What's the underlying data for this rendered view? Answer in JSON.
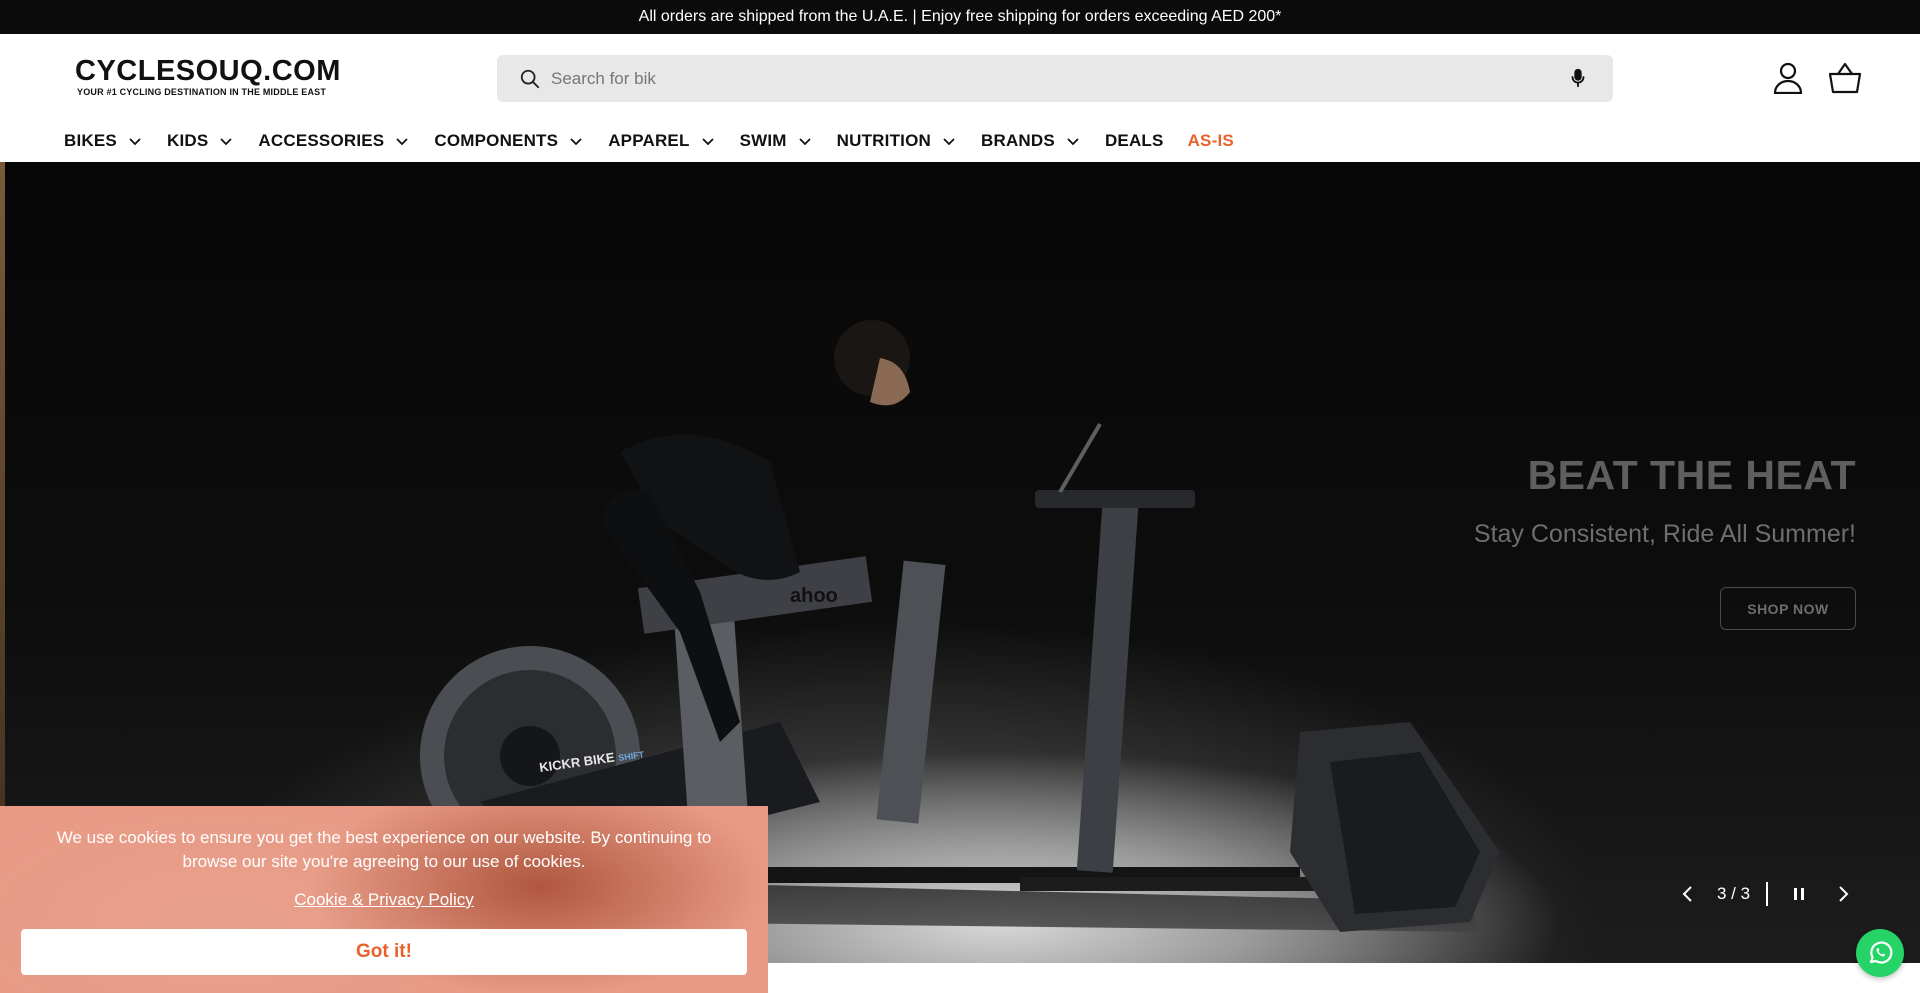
{
  "announcement": {
    "text": "All orders are shipped from the U.A.E. | Enjoy free shipping for orders exceeding AED 200*"
  },
  "header": {
    "logo_main": "CYCLESOUQ.COM",
    "logo_tagline": "YOUR #1 CYCLING DESTINATION IN THE MIDDLE EAST",
    "search": {
      "value": "",
      "placeholder": "Search for bik"
    },
    "icons": [
      "search-icon",
      "microphone-icon",
      "account-icon",
      "cart-icon"
    ]
  },
  "nav": {
    "items": [
      {
        "label": "BIKES",
        "has_dropdown": true
      },
      {
        "label": "KIDS",
        "has_dropdown": true
      },
      {
        "label": "ACCESSORIES",
        "has_dropdown": true
      },
      {
        "label": "COMPONENTS",
        "has_dropdown": true
      },
      {
        "label": "APPAREL",
        "has_dropdown": true
      },
      {
        "label": "SWIM",
        "has_dropdown": true
      },
      {
        "label": "NUTRITION",
        "has_dropdown": true
      },
      {
        "label": "BRANDS",
        "has_dropdown": true
      },
      {
        "label": "DEALS",
        "has_dropdown": false
      },
      {
        "label": "AS-IS",
        "has_dropdown": false
      }
    ],
    "sale_color": "#e8622a"
  },
  "hero": {
    "title": "BEAT THE HEAT",
    "subtitle": "Stay Consistent, Ride All Summer!",
    "cta": "SHOP NOW",
    "trainer_label": "KICKR BIKE",
    "trainer_label_suffix": "SHIFT",
    "frame_brand": "ahoo",
    "slider": {
      "current": 3,
      "total": 3,
      "counter_text": "3 / 3"
    }
  },
  "cookie_banner": {
    "message": "We use cookies to ensure you get the best experience on our website. By continuing to browse our site you're agreeing to our use of cookies.",
    "link_text": "Cookie & Privacy Policy",
    "button_label": "Got it!"
  },
  "colors": {
    "announce_bg": "#0b0b0b",
    "accent": "#e8622a",
    "search_bg": "#e8e8e8",
    "whatsapp": "#25d366"
  }
}
